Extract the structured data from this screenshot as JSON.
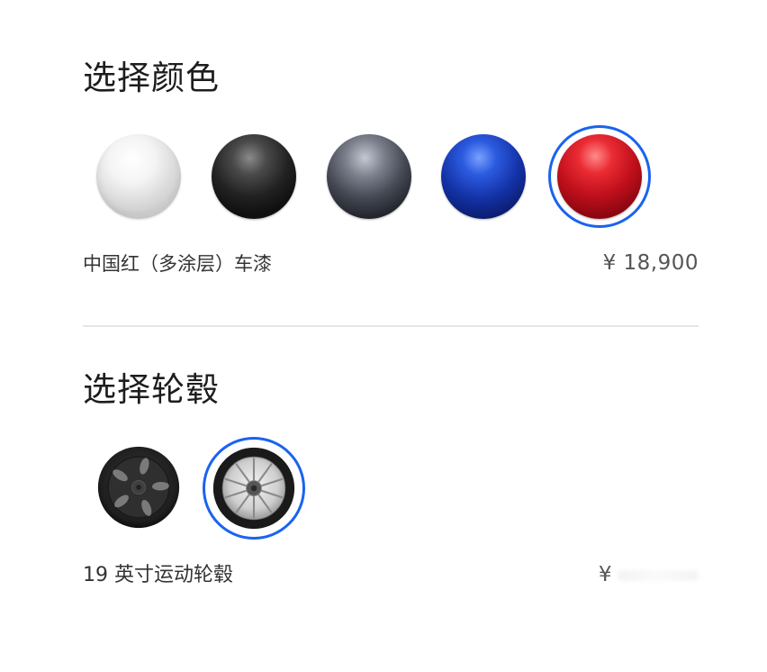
{
  "paint": {
    "title": "选择颜色",
    "swatches": [
      {
        "name": "white",
        "color": "#e6e6e6"
      },
      {
        "name": "black",
        "color": "#1c1c1c"
      },
      {
        "name": "midnight-silver",
        "color": "#3a3d45"
      },
      {
        "name": "deep-blue",
        "color": "#1433a8"
      },
      {
        "name": "red",
        "color": "#c0101c",
        "selected": true
      }
    ],
    "selected_label": "中国红（多涂层）车漆",
    "selected_price": "¥ 18,900",
    "ring_color": "#1a63f0"
  },
  "wheels": {
    "title": "选择轮毂",
    "options": [
      {
        "name": "18-inch-aero-wheel"
      },
      {
        "name": "19-inch-sport-wheel",
        "selected": true
      }
    ],
    "selected_label": "19 英寸运动轮毂",
    "price_symbol": "¥"
  }
}
